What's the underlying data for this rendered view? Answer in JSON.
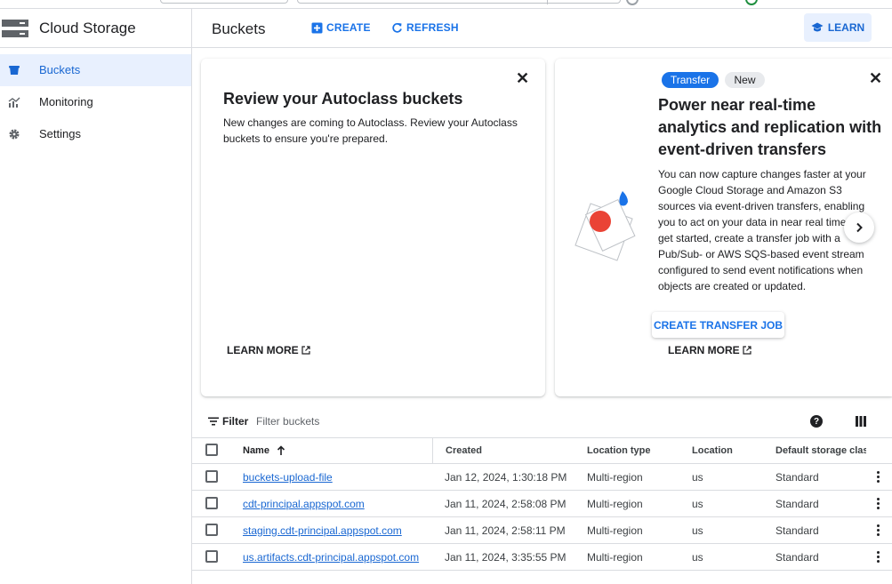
{
  "app": {
    "product_name": "Cloud Storage"
  },
  "sidebar": {
    "items": [
      {
        "label": "Buckets",
        "icon": "bucket-icon",
        "active": true
      },
      {
        "label": "Monitoring",
        "icon": "monitoring-icon",
        "active": false
      },
      {
        "label": "Settings",
        "icon": "gear-icon",
        "active": false
      }
    ]
  },
  "header": {
    "title": "Buckets",
    "create_label": "CREATE",
    "refresh_label": "REFRESH",
    "learn_label": "LEARN"
  },
  "autoclass_card": {
    "title": "Review your Autoclass buckets",
    "text": "New changes are coming to Autoclass. Review your Autoclass buckets to ensure you're prepared.",
    "learn_more": "LEARN MORE"
  },
  "transfer_card": {
    "chip_primary": "Transfer",
    "chip_secondary": "New",
    "title": "Power near real-time analytics and replication with event-driven transfers",
    "text": "You can now capture changes faster at your Google Cloud Storage and Amazon S3 sources via event-driven transfers, enabling you to act on your data in near real time. To get started, create a transfer job with a Pub/Sub- or AWS SQS-based event stream configured to send event notifications when objects are created or updated.",
    "cta": "CREATE TRANSFER JOB",
    "learn_more": "LEARN MORE"
  },
  "filter": {
    "label": "Filter",
    "placeholder": "Filter buckets"
  },
  "table": {
    "columns": {
      "name": "Name",
      "created": "Created",
      "location_type": "Location type",
      "location": "Location",
      "storage_class": "Default storage class"
    },
    "rows": [
      {
        "name": "buckets-upload-file",
        "created": "Jan 12, 2024, 1:30:18 PM",
        "location_type": "Multi-region",
        "location": "us",
        "storage_class": "Standard"
      },
      {
        "name": "cdt-principal.appspot.com",
        "created": "Jan 11, 2024, 2:58:08 PM",
        "location_type": "Multi-region",
        "location": "us",
        "storage_class": "Standard"
      },
      {
        "name": "staging.cdt-principal.appspot.com",
        "created": "Jan 11, 2024, 2:58:11 PM",
        "location_type": "Multi-region",
        "location": "us",
        "storage_class": "Standard"
      },
      {
        "name": "us.artifacts.cdt-principal.appspot.com",
        "created": "Jan 11, 2024, 3:35:55 PM",
        "location_type": "Multi-region",
        "location": "us",
        "storage_class": "Standard"
      }
    ]
  },
  "colors": {
    "accent": "#1a73e8",
    "active_bg": "#e8f0fe",
    "illustration_red": "#ea4335"
  }
}
